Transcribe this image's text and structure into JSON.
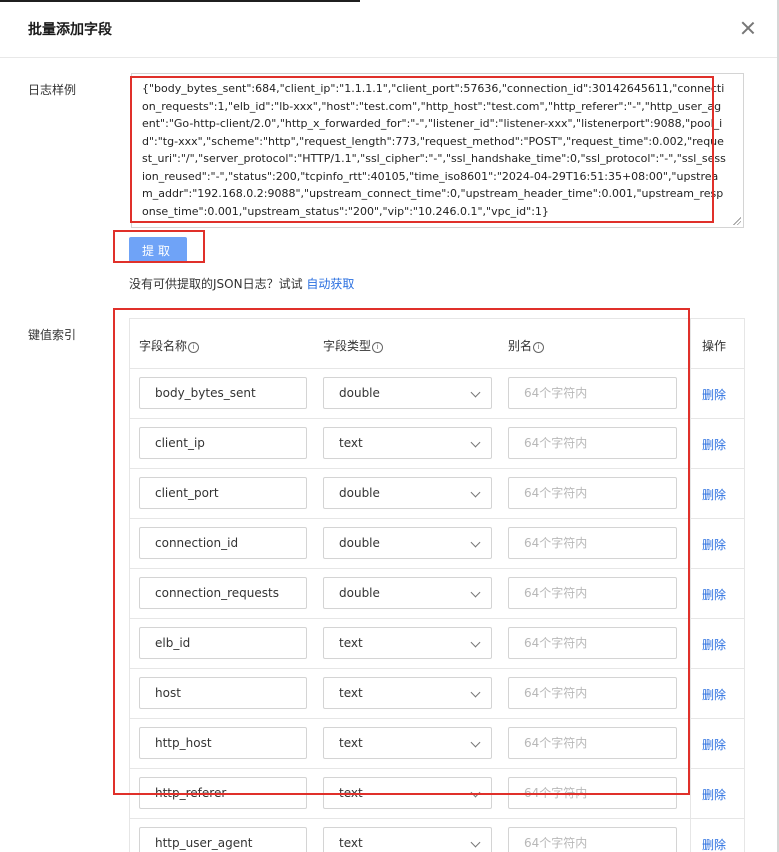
{
  "dialog": {
    "title": "批量添加字段",
    "close_icon": "close-icon"
  },
  "log_sample": {
    "label": "日志样例",
    "text": "{\"body_bytes_sent\":684,\"client_ip\":\"1.1.1.1\",\"client_port\":57636,\"connection_id\":30142645611,\"connection_requests\":1,\"elb_id\":\"lb-xxx\",\"host\":\"test.com\",\"http_host\":\"test.com\",\"http_referer\":\"-\",\"http_user_agent\":\"Go-http-client/2.0\",\"http_x_forwarded_for\":\"-\",\"listener_id\":\"listener-xxx\",\"listenerport\":9088,\"pool_id\":\"tg-xxx\",\"scheme\":\"http\",\"request_length\":773,\"request_method\":\"POST\",\"request_time\":0.002,\"request_uri\":\"/\",\"server_protocol\":\"HTTP/1.1\",\"ssl_cipher\":\"-\",\"ssl_handshake_time\":0,\"ssl_protocol\":\"-\",\"ssl_session_reused\":\"-\",\"status\":200,\"tcpinfo_rtt\":40105,\"time_iso8601\":\"2024-04-29T16:51:35+08:00\",\"upstream_addr\":\"192.168.0.2:9088\",\"upstream_connect_time\":0,\"upstream_header_time\":0.001,\"upstream_response_time\":0.001,\"upstream_status\":\"200\",\"vip\":\"10.246.0.1\",\"vpc_id\":1}"
  },
  "extract": {
    "button_label": "提取",
    "hint_prefix": "没有可供提取的JSON日志？试试 ",
    "hint_link": "自动获取"
  },
  "kv_index": {
    "label": "键值索引",
    "columns": {
      "name": "字段名称",
      "type": "字段类型",
      "alias": "别名",
      "op": "操作"
    },
    "alias_placeholder": "64个字符内",
    "delete_label": "删除",
    "info_glyph": "i",
    "rows": [
      {
        "name": "body_bytes_sent",
        "type": "double"
      },
      {
        "name": "client_ip",
        "type": "text"
      },
      {
        "name": "client_port",
        "type": "double"
      },
      {
        "name": "connection_id",
        "type": "double"
      },
      {
        "name": "connection_requests",
        "type": "double"
      },
      {
        "name": "elb_id",
        "type": "text"
      },
      {
        "name": "host",
        "type": "text"
      },
      {
        "name": "http_host",
        "type": "text"
      },
      {
        "name": "http_referer",
        "type": "text"
      },
      {
        "name": "http_user_agent",
        "type": "text"
      }
    ]
  },
  "colors": {
    "accent": "#2a6fe0",
    "button": "#6fa3f7",
    "highlight": "#e0302a"
  }
}
